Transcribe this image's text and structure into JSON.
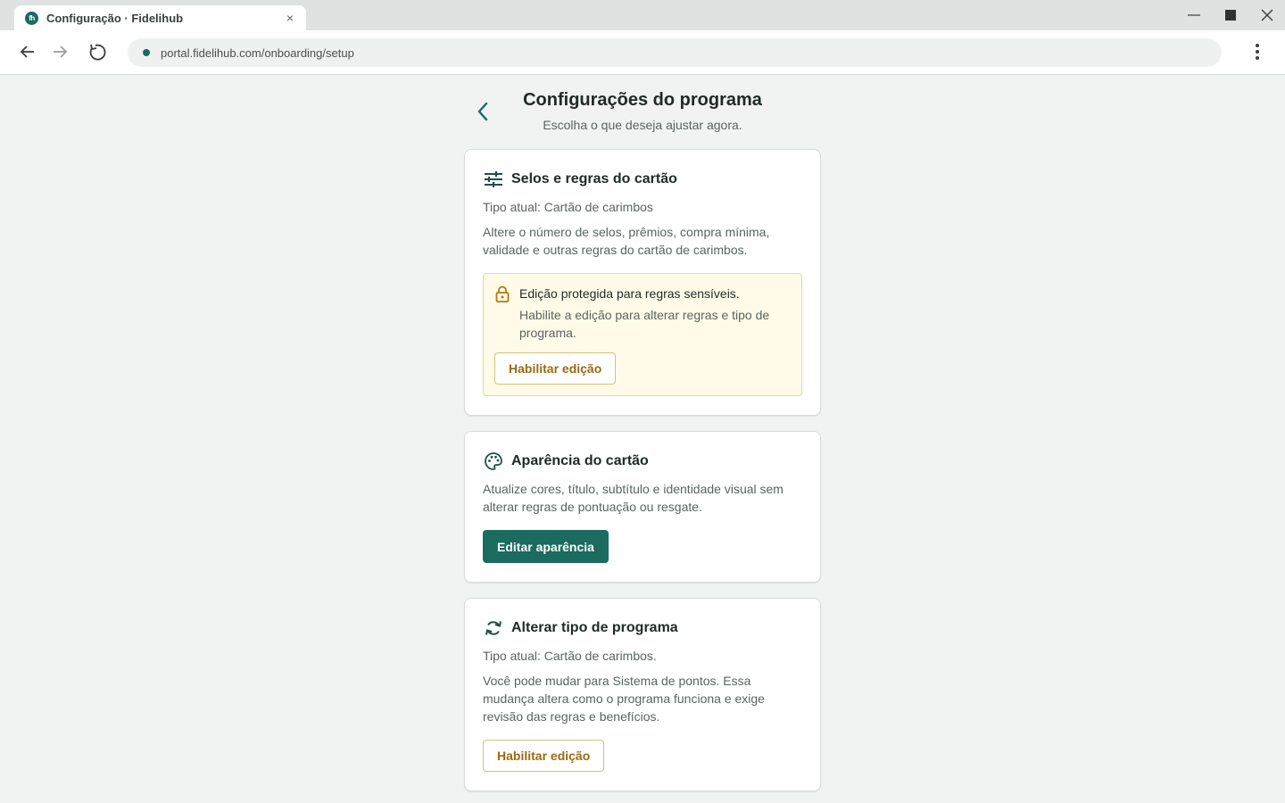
{
  "browser": {
    "tab_title": "Configuração · Fidelihub",
    "favicon_text": "fh",
    "tab_close": "×",
    "url": "portal.fidelihub.com/onboarding/setup"
  },
  "header": {
    "title": "Configurações do programa",
    "subtitle": "Escolha o que deseja ajustar agora."
  },
  "cards": [
    {
      "icon": "sliders-icon",
      "title": "Selos e regras do cartão",
      "current_type": "Tipo atual: Cartão de carimbos",
      "description": "Altere o número de selos, prêmios, compra mínima, validade e outras regras do cartão de carimbos.",
      "alert": {
        "icon": "lock-icon",
        "title": "Edição protegida para regras sensíveis.",
        "text": "Habilite a edição para alterar regras e tipo de programa.",
        "button": "Habilitar edição"
      }
    },
    {
      "icon": "palette-icon",
      "title": "Aparência do cartão",
      "description": "Atualize cores, título, subtítulo e identidade visual sem alterar regras de pontuação ou resgate.",
      "button": "Editar aparência"
    },
    {
      "icon": "refresh-icon",
      "title": "Alterar tipo de programa",
      "current_type": "Tipo atual: Cartão de carimbos.",
      "description": "Você pode mudar para Sistema de pontos. Essa mudança altera como o programa funciona e exige revisão das regras e benefícios.",
      "button": "Habilitar edição"
    }
  ],
  "colors": {
    "brand": "#1b6b5f",
    "warning_border": "#ead59a",
    "warning_bg": "#fffbe8",
    "warning_text": "#9a6a10"
  }
}
